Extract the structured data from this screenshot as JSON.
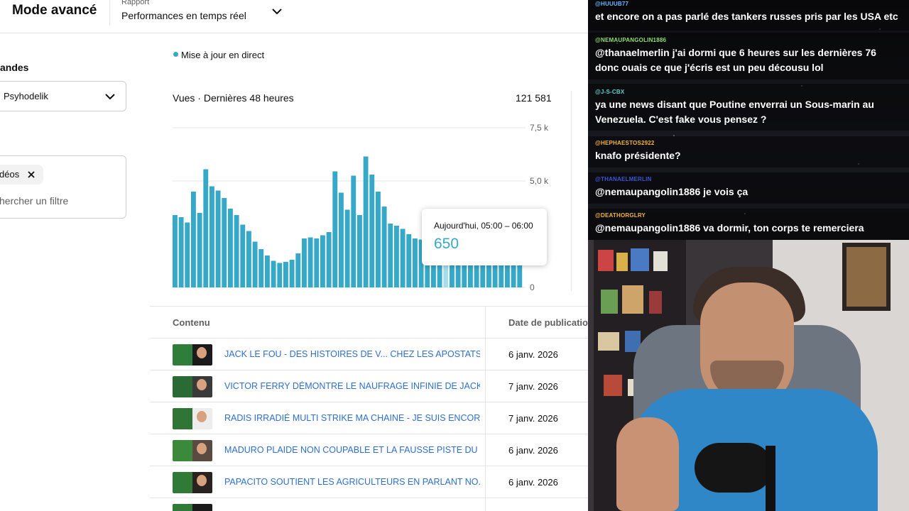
{
  "header": {
    "mode_title": "Mode avancé",
    "report_label": "Rapport",
    "report_value": "Performances en temps réel"
  },
  "sidebar": {
    "section_title": "andes",
    "channel_value": "Psyhodelik",
    "filter_chip": "déos",
    "filter_placeholder": "hercher un filtre"
  },
  "live": {
    "label": "Mise à jour en direct",
    "color": "#36a9c9"
  },
  "views_card": {
    "title": "Vues · Dernières 48 heures",
    "total": "121 581",
    "tooltip_label": "Aujourd'hui, 05:00 – 06:00",
    "tooltip_value": "650"
  },
  "chart_data": {
    "type": "bar",
    "title": "Vues · Dernières 48 heures",
    "ylim": [
      0,
      7500
    ],
    "yticks": [
      "0",
      "5,0 k",
      "7,5 k"
    ],
    "grid": true,
    "bar_color": "#36a9c9",
    "highlight_color": "#a8dceb",
    "highlight_index": 44,
    "values": [
      3400,
      3300,
      3050,
      4500,
      3500,
      5550,
      4750,
      4550,
      4200,
      3700,
      3400,
      2950,
      2650,
      2150,
      1800,
      1500,
      1250,
      1150,
      1200,
      1300,
      1600,
      2300,
      2350,
      2300,
      2450,
      2600,
      5450,
      4450,
      3650,
      5250,
      3400,
      6150,
      5300,
      4500,
      3800,
      3000,
      2900,
      2750,
      2500,
      2300,
      2250,
      2150,
      1900,
      1600,
      1300,
      1050,
      1450,
      1800,
      2000,
      1950,
      1800,
      2000,
      1950,
      1750,
      2300,
      1950,
      2150
    ]
  },
  "table": {
    "col_content": "Contenu",
    "col_date": "Date de publication",
    "rows": [
      {
        "title": "JACK LE FOU - DES HISTOIRES DE V... CHEZ LES APOSTATS...",
        "date": "6 janv. 2026"
      },
      {
        "title": "VICTOR FERRY DÉMONTRE LE NAUFRAGE INFINIE DE JACK...",
        "date": "7 janv. 2026"
      },
      {
        "title": "RADIS IRRADIÉ MULTI STRIKE MA CHAINE - JE SUIS ENCOR...",
        "date": "7 janv. 2026"
      },
      {
        "title": "MADURO PLAIDE NON COUPABLE ET LA FAUSSE PISTE DU ...",
        "date": "6 janv. 2026"
      },
      {
        "title": "PAPACITO SOUTIENT LES AGRICULTEURS EN PARLANT NO...",
        "date": "6 janv. 2026"
      }
    ]
  },
  "chat": {
    "messages": [
      {
        "user": "@HUUUB77",
        "user_color": "#69b7ff",
        "text": "et encore on a pas parlé des tankers russes pris par les USA etc"
      },
      {
        "user": "@NEMAUPANGOLIN1886",
        "user_color": "#8de06a",
        "text": "@thanaelmerlin j'ai dormi que 6 heures sur les dernières 76 donc ouais ce que j'écris est un peu décousu lol"
      },
      {
        "user": "@J-S-CBX",
        "user_color": "#5fd0c8",
        "text": "ya une news disant que Poutine enverrai un Sous-marin au Venezuela. C'est fake vous pensez ?"
      },
      {
        "user": "@HEPHAESTOS2922",
        "user_color": "#f0b640",
        "text": "knafo présidente?"
      },
      {
        "user": "@THANAELMERLIN",
        "user_color": "#3b55d8",
        "text": "@nemaupangolin1886 je vois ça"
      },
      {
        "user": "@DEATHORGLRY",
        "user_color": "#f0b640",
        "text": "@nemaupangolin1886 va dormir, ton corps te remerciera"
      }
    ]
  }
}
